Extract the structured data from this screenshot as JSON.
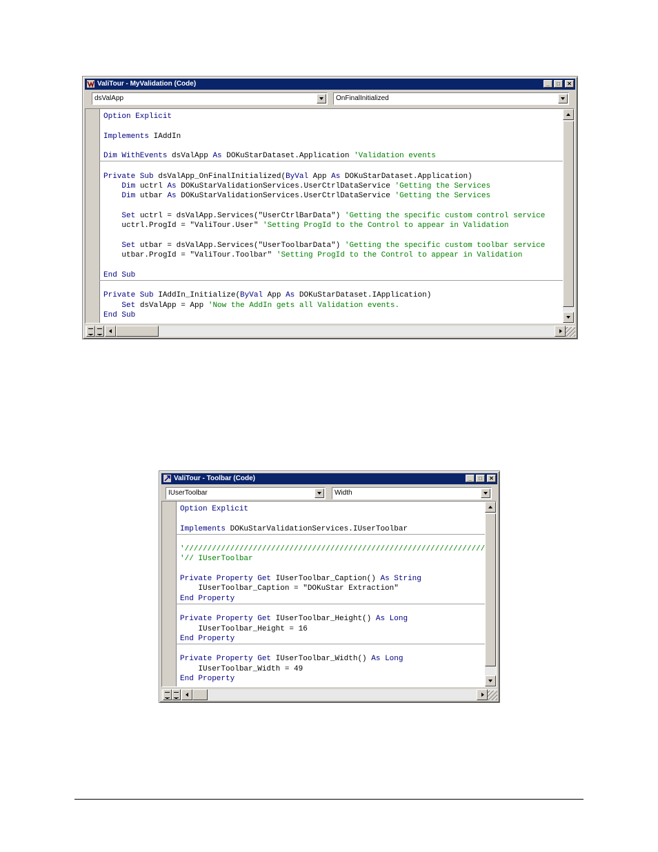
{
  "window1": {
    "title": "ValiTour - MyValidation (Code)",
    "object_combo": "dsValApp",
    "proc_combo": "OnFinalInitialized",
    "lines": [
      [
        [
          "kw",
          "Option Explicit"
        ]
      ],
      [],
      [
        [
          "kw",
          "Implements"
        ],
        [
          "t",
          " IAddIn"
        ]
      ],
      [],
      [
        [
          "kw",
          "Dim WithEvents"
        ],
        [
          "t",
          " dsValApp "
        ],
        [
          "kw",
          "As"
        ],
        [
          "t",
          " DOKuStarDataset.Application "
        ],
        [
          "cm",
          "'Validation events"
        ]
      ],
      [],
      [
        [
          "kw",
          "Private Sub"
        ],
        [
          "t",
          " dsValApp_OnFinalInitialized("
        ],
        [
          "kw",
          "ByVal"
        ],
        [
          "t",
          " App "
        ],
        [
          "kw",
          "As"
        ],
        [
          "t",
          " DOKuStarDataset.Application)"
        ]
      ],
      [
        [
          "t",
          "    "
        ],
        [
          "kw",
          "Dim"
        ],
        [
          "t",
          " uctrl "
        ],
        [
          "kw",
          "As"
        ],
        [
          "t",
          " DOKuStarValidationServices.UserCtrlDataService "
        ],
        [
          "cm",
          "'Getting the Services"
        ]
      ],
      [
        [
          "t",
          "    "
        ],
        [
          "kw",
          "Dim"
        ],
        [
          "t",
          " utbar "
        ],
        [
          "kw",
          "As"
        ],
        [
          "t",
          " DOKuStarValidationServices.UserCtrlDataService "
        ],
        [
          "cm",
          "'Getting the Services"
        ]
      ],
      [],
      [
        [
          "t",
          "    "
        ],
        [
          "kw",
          "Set"
        ],
        [
          "t",
          " uctrl = dsValApp.Services(\"UserCtrlBarData\") "
        ],
        [
          "cm",
          "'Getting the specific custom control service"
        ]
      ],
      [
        [
          "t",
          "    uctrl.ProgId = \"ValiTour.User\" "
        ],
        [
          "cm",
          "'Setting ProgId to the Control to appear in Validation"
        ]
      ],
      [],
      [
        [
          "t",
          "    "
        ],
        [
          "kw",
          "Set"
        ],
        [
          "t",
          " utbar = dsValApp.Services(\"UserToolbarData\") "
        ],
        [
          "cm",
          "'Getting the specific custom toolbar service"
        ]
      ],
      [
        [
          "t",
          "    utbar.ProgId = \"ValiTour.Toolbar\" "
        ],
        [
          "cm",
          "'Setting ProgId to the Control to appear in Validation"
        ]
      ],
      [],
      [
        [
          "kw",
          "End Sub"
        ]
      ],
      [],
      [
        [
          "kw",
          "Private Sub"
        ],
        [
          "t",
          " IAddIn_Initialize("
        ],
        [
          "kw",
          "ByVal"
        ],
        [
          "t",
          " App "
        ],
        [
          "kw",
          "As"
        ],
        [
          "t",
          " DOKuStarDataset.IApplication)"
        ]
      ],
      [
        [
          "t",
          "    "
        ],
        [
          "kw",
          "Set"
        ],
        [
          "t",
          " dsValApp = App "
        ],
        [
          "cm",
          "'Now the AddIn gets all Validation events."
        ]
      ],
      [
        [
          "kw",
          "End Sub"
        ]
      ]
    ]
  },
  "window2": {
    "title": "ValiTour - Toolbar (Code)",
    "object_combo": "IUserToolbar",
    "proc_combo": "Width",
    "lines": [
      [
        [
          "kw",
          "Option Explicit"
        ]
      ],
      [],
      [
        [
          "kw",
          "Implements"
        ],
        [
          "t",
          " DOKuStarValidationServices.IUserToolbar"
        ]
      ],
      [],
      [
        [
          "cm",
          "'/////////////////////////////////////////////////////////////////////"
        ]
      ],
      [
        [
          "cm",
          "'// IUserToolbar"
        ]
      ],
      [],
      [
        [
          "kw",
          "Private Property Get"
        ],
        [
          "t",
          " IUserToolbar_Caption() "
        ],
        [
          "kw",
          "As String"
        ]
      ],
      [
        [
          "t",
          "    IUserToolbar_Caption = \"DOKuStar Extraction\""
        ]
      ],
      [
        [
          "kw",
          "End Property"
        ]
      ],
      [],
      [
        [
          "kw",
          "Private Property Get"
        ],
        [
          "t",
          " IUserToolbar_Height() "
        ],
        [
          "kw",
          "As Long"
        ]
      ],
      [
        [
          "t",
          "    IUserToolbar_Height = 16"
        ]
      ],
      [
        [
          "kw",
          "End Property"
        ]
      ],
      [],
      [
        [
          "kw",
          "Private Property Get"
        ],
        [
          "t",
          " IUserToolbar_Width() "
        ],
        [
          "kw",
          "As Long"
        ]
      ],
      [
        [
          "t",
          "    IUserToolbar_Width = 49"
        ]
      ],
      [
        [
          "kw",
          "End Property"
        ]
      ]
    ]
  },
  "icons": [
    "vb-code-icon",
    "minimize-icon",
    "maximize-icon",
    "close-icon",
    "dropdown-arrow-icon",
    "scroll-up-icon",
    "scroll-down-icon",
    "scroll-left-icon",
    "scroll-right-icon",
    "procedure-view-icon",
    "full-module-view-icon"
  ]
}
